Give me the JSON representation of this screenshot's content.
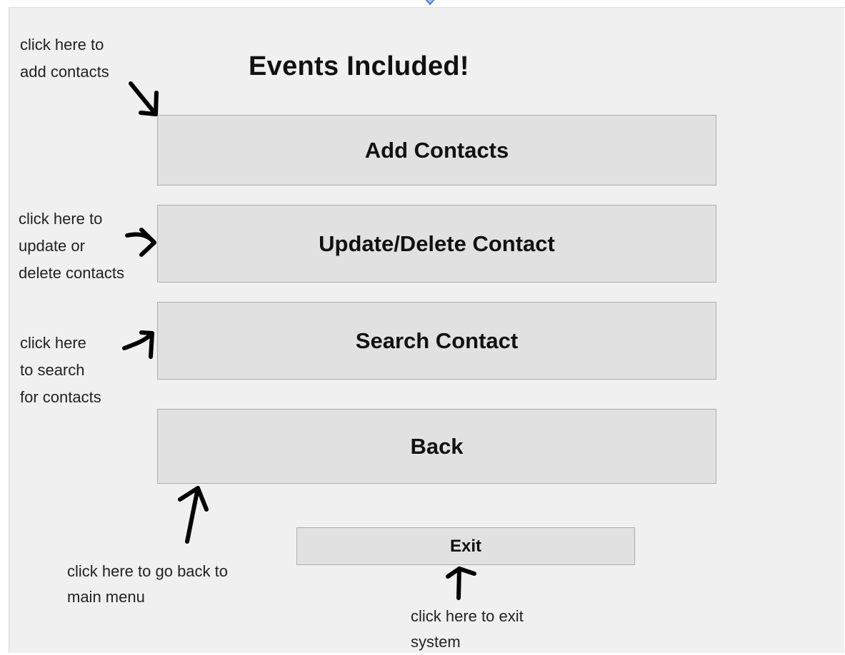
{
  "window": {
    "title": "Events Included!"
  },
  "buttons": {
    "add": "Add Contacts",
    "update": "Update/Delete Contact",
    "search": "Search Contact",
    "back": "Back",
    "exit": "Exit"
  },
  "annotations": {
    "add": [
      "click here to",
      "add contacts"
    ],
    "update": [
      "click here to",
      "update or",
      "delete contacts"
    ],
    "search": [
      "click here",
      "to search",
      "for contacts"
    ],
    "back": [
      "click here to go back to",
      "main menu"
    ],
    "exit": [
      "click here to exit",
      "system"
    ]
  },
  "icons": {
    "top_marker": "blue-chevron-down-icon",
    "arrows": "hand-drawn-arrow-icon"
  },
  "colors": {
    "background": "#f0f0f0",
    "button": "#e1e1e1",
    "button_border": "#adadad",
    "marker": "#5b8dd6"
  }
}
